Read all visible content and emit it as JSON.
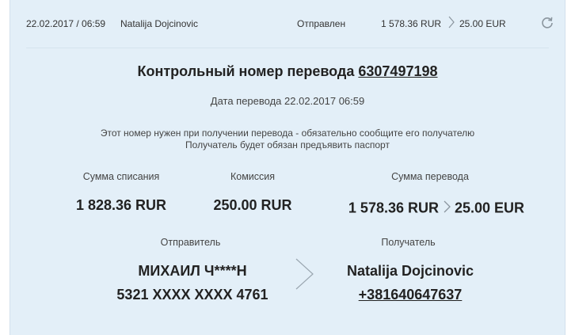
{
  "header": {
    "datetime": "22.02.2017 / 06:59",
    "name": "Natalija Dojcinovic",
    "status": "Отправлен",
    "amount_from": "1 578.36 RUR",
    "amount_to": "25.00 EUR",
    "refresh_icon": "refresh-icon"
  },
  "control": {
    "label": "Контрольный номер перевода",
    "number": "6307497198"
  },
  "transfer_date": "Дата перевода 22.02.2017 06:59",
  "notes": [
    "Этот номер нужен при получении перевода - обязательно сообщите его получателю",
    "Получатель будет обязан предъявить паспорт"
  ],
  "amounts": {
    "debit_label": "Сумма списания",
    "debit_value": "1 828.36 RUR",
    "fee_label": "Комиссия",
    "fee_value": "250.00 RUR",
    "transfer_label": "Сумма перевода",
    "transfer_from": "1 578.36 RUR",
    "transfer_to": "25.00 EUR"
  },
  "sender": {
    "label": "Отправитель",
    "name": "МИХАИЛ Ч****Н",
    "card": "5321 XXXX XXXX 4761"
  },
  "recipient": {
    "label": "Получатель",
    "name": "Natalija Dojcinovic",
    "phone": "+381640647637"
  },
  "colors": {
    "card_background": "#e3eff8",
    "text": "#222222",
    "chevron": "#9aa6b0"
  }
}
